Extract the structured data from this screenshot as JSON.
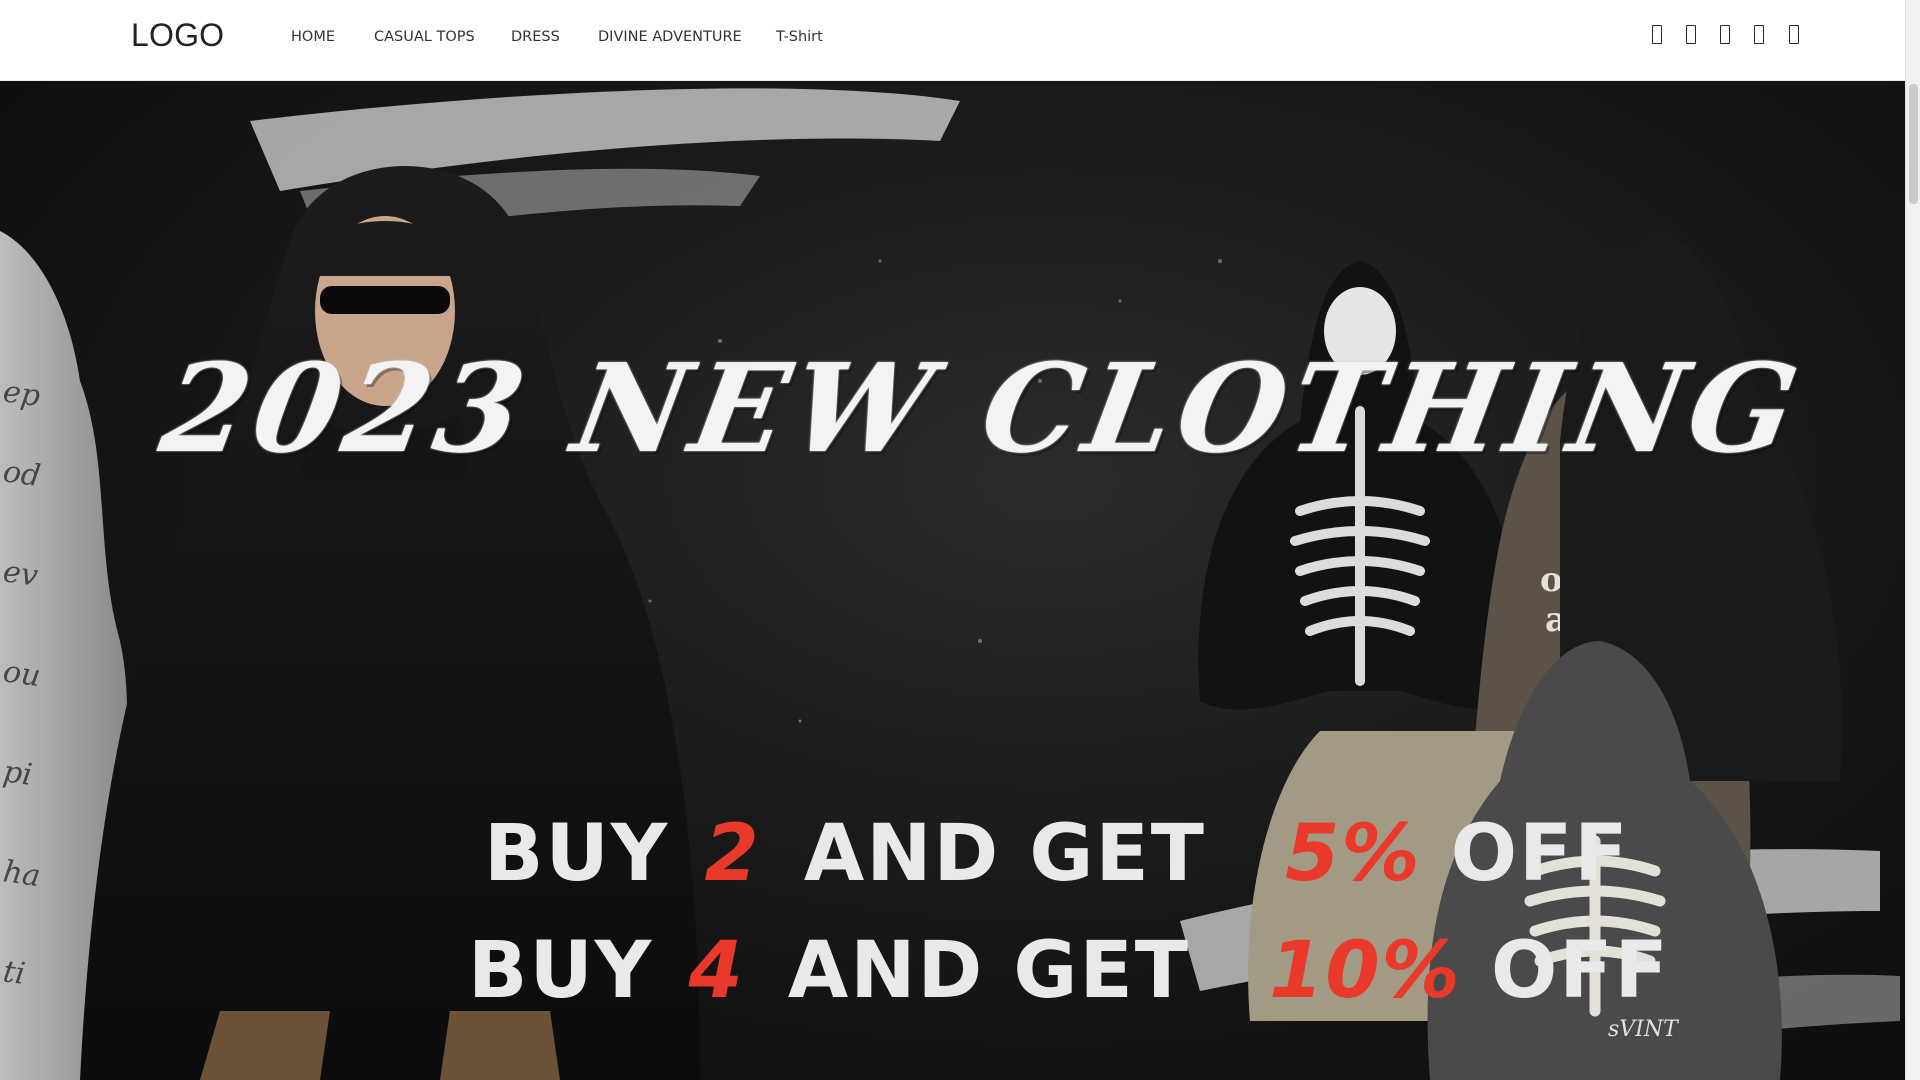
{
  "header": {
    "logo": "LOGO",
    "nav": [
      "HOME",
      "CASUAL TOPS",
      "DRESS",
      "DIVINE ADVENTURE",
      "T-Shirt"
    ],
    "icons": [
      "search-icon",
      "user-icon",
      "heart-icon",
      "compare-icon",
      "cart-icon"
    ],
    "icon_glyph": "▯"
  },
  "hero": {
    "headline": "2023 NEW CLOTHING",
    "offers": [
      {
        "pre": "BUY",
        "qty": "2",
        "mid": "AND GET",
        "pct": "5%",
        "post": "OFF"
      },
      {
        "pre": "BUY",
        "qty": "4",
        "mid": "AND GET",
        "pct": "10%",
        "post": "OFF"
      }
    ],
    "colors": {
      "accent": "#e8392a",
      "text": "#e9e9e9",
      "background": "#151515"
    }
  }
}
